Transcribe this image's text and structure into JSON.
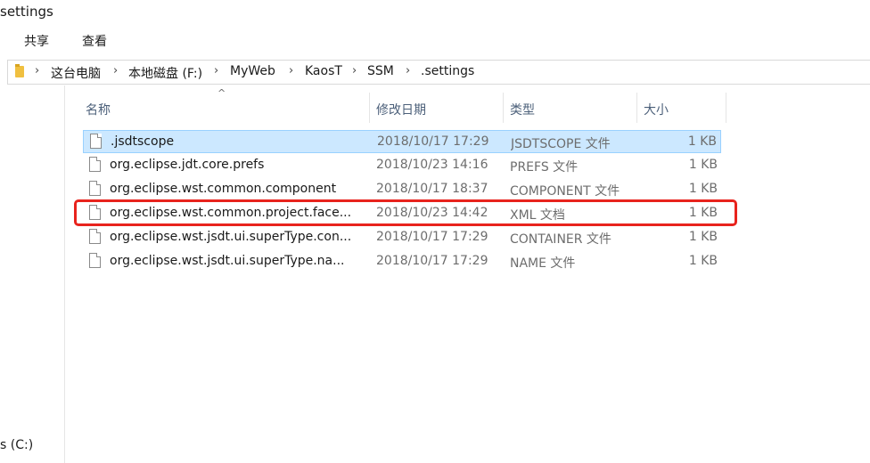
{
  "window": {
    "title": "settings"
  },
  "ribbon": {
    "tabs": [
      "共享",
      "查看"
    ]
  },
  "address_bar": {
    "crumbs": [
      "这台电脑",
      "本地磁盘 (F:)",
      "MyWeb",
      "KaosT",
      "SSM",
      ".settings"
    ]
  },
  "columns": {
    "name": "名称",
    "date": "修改日期",
    "type": "类型",
    "size": "大小"
  },
  "files": [
    {
      "name": ".jsdtscope",
      "date": "2018/10/17 17:29",
      "type": "JSDTSCOPE 文件",
      "size": "1 KB",
      "selected": true
    },
    {
      "name": "org.eclipse.jdt.core.prefs",
      "date": "2018/10/23 14:16",
      "type": "PREFS 文件",
      "size": "1 KB"
    },
    {
      "name": "org.eclipse.wst.common.component",
      "date": "2018/10/17 18:37",
      "type": "COMPONENT 文件",
      "size": "1 KB"
    },
    {
      "name": "org.eclipse.wst.common.project.face...",
      "date": "2018/10/23 14:42",
      "type": "XML 文档",
      "size": "1 KB",
      "highlighted": true
    },
    {
      "name": "org.eclipse.wst.jsdt.ui.superType.con...",
      "date": "2018/10/17 17:29",
      "type": "CONTAINER 文件",
      "size": "1 KB"
    },
    {
      "name": "org.eclipse.wst.jsdt.ui.superType.na...",
      "date": "2018/10/17 17:29",
      "type": "NAME 文件",
      "size": "1 KB"
    }
  ],
  "nav_pane": {
    "drive_label": "s (C:)"
  },
  "colors": {
    "selection": "#cce8ff",
    "annotation": "#e8231d",
    "header_text": "#4c607a"
  }
}
